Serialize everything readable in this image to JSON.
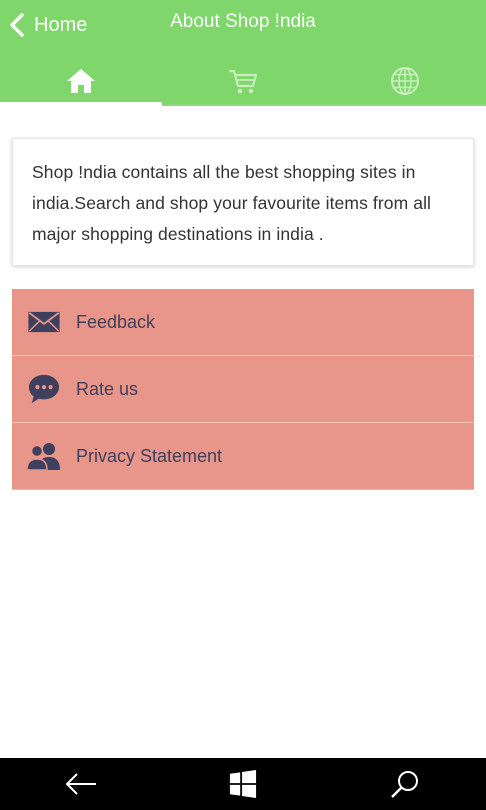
{
  "header": {
    "back_label": "Home",
    "title": "About Shop !ndia"
  },
  "tabs": [
    {
      "name": "home",
      "icon": "home-icon",
      "active": true
    },
    {
      "name": "cart",
      "icon": "cart-icon",
      "active": false
    },
    {
      "name": "web",
      "icon": "globe-icon",
      "active": false
    }
  ],
  "about": {
    "text": "Shop !ndia contains all the best shopping sites in india.Search and shop your favourite items from all major shopping destinations in india ."
  },
  "menu": [
    {
      "label": "Feedback",
      "icon": "envelope-icon"
    },
    {
      "label": "Rate us",
      "icon": "chat-bubble-icon"
    },
    {
      "label": "Privacy Statement",
      "icon": "users-icon"
    }
  ],
  "colors": {
    "header": "#7fd66b",
    "menu_bg": "#e8958a",
    "menu_text": "#3f3f5e"
  },
  "system_bar": {
    "buttons": [
      "back-arrow-icon",
      "windows-icon",
      "search-icon"
    ]
  }
}
